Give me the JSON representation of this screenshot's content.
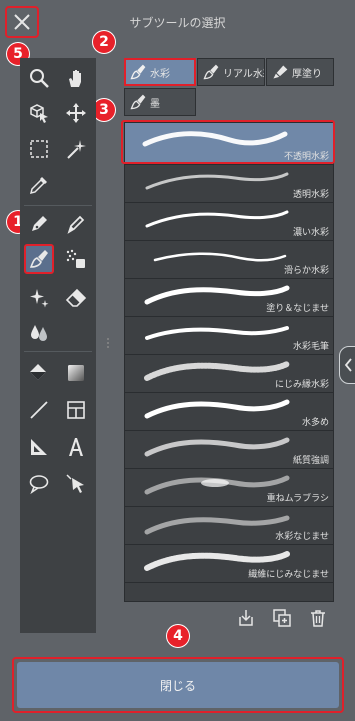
{
  "header": {
    "title": "サブツールの選択"
  },
  "badges": [
    "1",
    "2",
    "3",
    "4",
    "5"
  ],
  "tools": [
    {
      "name": "zoom-icon"
    },
    {
      "name": "hand-icon"
    },
    {
      "name": "object-select-icon"
    },
    {
      "name": "move-icon"
    },
    {
      "name": "selection-marquee-icon"
    },
    {
      "name": "auto-select-wand-icon"
    },
    {
      "name": "eyedropper-icon"
    },
    {
      "name": "pen-icon"
    },
    {
      "name": "pencil-icon"
    },
    {
      "name": "brush-icon"
    },
    {
      "name": "airbrush-icon"
    },
    {
      "name": "decoration-sparkle-icon"
    },
    {
      "name": "eraser-icon"
    },
    {
      "name": "blend-drops-icon"
    },
    {
      "name": "fill-bucket-icon"
    },
    {
      "name": "gradient-icon"
    },
    {
      "name": "line-icon"
    },
    {
      "name": "frame-border-icon"
    },
    {
      "name": "ruler-icon"
    },
    {
      "name": "text-icon"
    },
    {
      "name": "balloon-icon"
    },
    {
      "name": "correct-line-icon"
    }
  ],
  "tabs": [
    {
      "label": "水彩",
      "selected": true
    },
    {
      "label": "リアル水彩",
      "selected": false
    },
    {
      "label": "厚塗り",
      "selected": false
    },
    {
      "label": "墨",
      "selected": false
    }
  ],
  "brushes": [
    {
      "label": "不透明水彩",
      "selected": true
    },
    {
      "label": "透明水彩"
    },
    {
      "label": "濃い水彩"
    },
    {
      "label": "滑らか水彩"
    },
    {
      "label": "塗り＆なじませ"
    },
    {
      "label": "水彩毛筆"
    },
    {
      "label": "にじみ縁水彩"
    },
    {
      "label": "水多め"
    },
    {
      "label": "紙質強調"
    },
    {
      "label": "重ねムラブラシ"
    },
    {
      "label": "水彩なじませ"
    },
    {
      "label": "繊維にじみなじませ"
    }
  ],
  "list_actions": [
    {
      "name": "import-icon"
    },
    {
      "name": "duplicate-icon"
    },
    {
      "name": "delete-icon"
    }
  ],
  "footer": {
    "close_label": "閉じる"
  },
  "colors": {
    "accent": "#e0202a",
    "selection": "#7088a8",
    "panel": "#3e4144",
    "background": "#5f6368"
  }
}
